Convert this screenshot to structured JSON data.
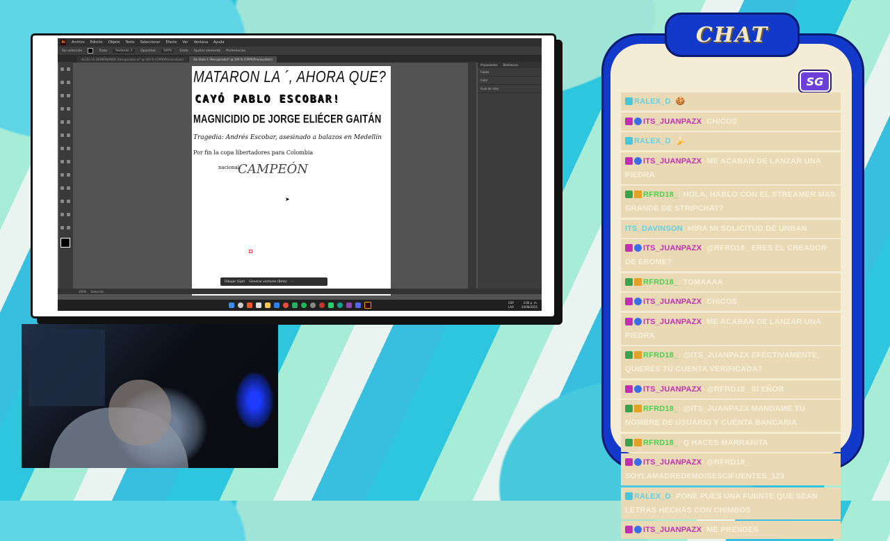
{
  "overlay": {
    "chat_title": "CHAT",
    "logo_text": "SG"
  },
  "illustrator": {
    "menu": [
      "Archivo",
      "Edición",
      "Objeto",
      "Texto",
      "Seleccionar",
      "Efecto",
      "Ver",
      "Ventana",
      "Ayuda"
    ],
    "control_bar": {
      "selection": "Sin selección",
      "trazo": "Trazo",
      "brush": "Redondo 3",
      "opacidad_label": "Opacidad",
      "opacidad_value": "100%",
      "estilo_label": "Estilo",
      "align_label": "Ajustar elemento",
      "prefs_label": "Preferencias"
    },
    "tabs": [
      {
        "label": "ALCES VS DESMONANDO (Recuperado).ai* @ 100 % (CMYK/Previsualizar)",
        "active": false
      },
      {
        "label": "Sin título-1 (Recuperado)* @ 100 % (CMYK/Previsualizar)",
        "active": true
      }
    ],
    "artboard_lines": [
      "MATARON LA ´, AHORA QUE?",
      "CAYÓ PABLO ESCOBAR!",
      "MAGNICIDIO DE JORGE ELIÉCER GAITÁN",
      "Tragedia: Andrés Escobar, asesinado a balazos en Medellín",
      "Por fin la copa libertadores para Colombia",
      "nacional.",
      "CAMPEÓN"
    ],
    "context_bar": {
      "draw_label": "Dibujar (Gpt)",
      "vectors_label": "Generar vectores (Beta)",
      "more_label": "···"
    },
    "right_panel": {
      "tabs": [
        "Propiedades",
        "Bibliotecas"
      ],
      "rows": [
        "Capas",
        "Color",
        "Guía de color"
      ]
    },
    "status": {
      "zoom": "100%",
      "tool": "Selección"
    },
    "taskbar": {
      "lang_top": "ESP",
      "lang_bottom": "LAA",
      "time": "3:06 p. m.",
      "date": "24/08/2025"
    }
  },
  "chat": [
    {
      "badges": [
        "sg"
      ],
      "user": "RALEX_D",
      "color": "#5fd2e6",
      "text": "🍪"
    },
    {
      "badges": [
        "heart",
        "verified"
      ],
      "user": "ITS_JUANPAZX",
      "color": "#c12fb3",
      "text": "CHICOS"
    },
    {
      "badges": [
        "sg"
      ],
      "user": "RALEX_D",
      "color": "#5fd2e6",
      "text": "🍌"
    },
    {
      "badges": [
        "heart",
        "verified"
      ],
      "user": "ITS_JUANPAZX",
      "color": "#c12fb3",
      "text": "ME ACABAN DE LANZAR UNA PIEDRA"
    },
    {
      "badges": [
        "check",
        "crown"
      ],
      "user": "RFRD18_",
      "color": "#46d24a",
      "text": "HOLA, HABLO CON EL STREAMER MAS GRANDE DE STRIPCHAT?"
    },
    {
      "badges": [],
      "user": "ITS_DAVINSON",
      "color": "#5fd2e6",
      "text": "MIRA MI SOLICITUD DE UNBAN"
    },
    {
      "badges": [
        "heart",
        "verified"
      ],
      "user": "ITS_JUANPAZX",
      "color": "#c12fb3",
      "text": "@RFRD18_ ERES EL CREADOR DE EROME?"
    },
    {
      "badges": [
        "check",
        "crown"
      ],
      "user": "RFRD18_",
      "color": "#46d24a",
      "text": "TOMAAAA"
    },
    {
      "badges": [
        "heart",
        "verified"
      ],
      "user": "ITS_JUANPAZX",
      "color": "#c12fb3",
      "text": "CHICOS"
    },
    {
      "badges": [
        "heart",
        "verified"
      ],
      "user": "ITS_JUANPAZX",
      "color": "#c12fb3",
      "text": "ME ACABAN DE LANZAR UNA PIEDRA"
    },
    {
      "badges": [
        "check",
        "crown"
      ],
      "user": "RFRD18_",
      "color": "#46d24a",
      "text": "@ITS_JUANPAZX EFECTIVAMENTE, QUIERES TU CUENTA VERIFICADA?"
    },
    {
      "badges": [
        "heart",
        "verified"
      ],
      "user": "ITS_JUANPAZX",
      "color": "#c12fb3",
      "text": "@RFRD18_ SI EÑOR"
    },
    {
      "badges": [
        "check",
        "crown"
      ],
      "user": "RFRD18_",
      "color": "#46d24a",
      "text": "@ITS_JUANPAZX MANDAME TU NOMBRE DE USUARIO Y CUENTA BANCARIA"
    },
    {
      "badges": [
        "check",
        "crown"
      ],
      "user": "RFRD18_",
      "color": "#46d24a",
      "text": "Q HACES MARRANITA"
    },
    {
      "badges": [
        "heart",
        "verified"
      ],
      "user": "ITS_JUANPAZX",
      "color": "#c12fb3",
      "text": "@RFRD18_ SOYLAMADREDEMOISESCIFUENTES_123"
    },
    {
      "badges": [
        "sg"
      ],
      "user": "RALEX_D",
      "color": "#5fd2e6",
      "text": "PONE PUES UNA FUENTE QUE SEAN LETRAS HECHAS CON CHIMBOS"
    },
    {
      "badges": [
        "heart",
        "verified"
      ],
      "user": "ITS_JUANPAZX",
      "color": "#c12fb3",
      "text": "ME PRENDES"
    }
  ]
}
